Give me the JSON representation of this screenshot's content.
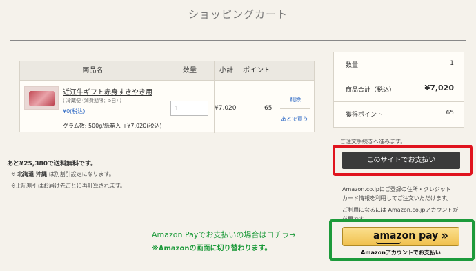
{
  "page": {
    "title": "ショッピングカート"
  },
  "cart": {
    "headers": {
      "product": "商品名",
      "quantity": "数量",
      "subtotal": "小計",
      "points": "ポイント"
    },
    "item": {
      "name": "近江牛ギフト赤身すきやき用",
      "note": "( 冷蔵便 (消費期限：5日) )",
      "price": "¥0(税込)",
      "option": "グラム数: 500g/紙箱入 +¥7,020(税込)",
      "quantity": "1",
      "subtotal": "¥7,020",
      "points": "65",
      "delete_label": "削除",
      "buy_later_label": "あとで買う"
    }
  },
  "shipping": {
    "free_shipping": "あと¥25,380で送料無料です。",
    "note1_prefix": "※",
    "note1_bold": "北海道 沖縄",
    "note1_suffix": "は別割引設定になります。",
    "note2": "※上記割引はお届け先ごとに再計算されます。"
  },
  "summary": {
    "quantity_label": "数量",
    "quantity_value": "1",
    "total_label": "商品合計（税込）",
    "total_value": "¥7,020",
    "points_label": "獲得ポイント",
    "points_value": "65"
  },
  "checkout": {
    "proceed_text": "ご注文手続きへ進みます。",
    "site_pay_label": "このサイトでお支払い",
    "amazon_info_1": "Amazon.co.jpにご登録の住所・クレジット",
    "amazon_info_2": "カード情報を利用してご注文いただけます。",
    "amazon_info_3": "ご利用になるには Amazon.co.jpアカウントが",
    "amazon_info_4": "必要です。",
    "amazon_logo": "amazon pay",
    "amazon_chevron": "»",
    "amazon_caption": "Amazonアカウントでお支払い"
  },
  "annotations": {
    "green_line1": "Amazon Payでお支払いの場合はコチラ→",
    "green_line2": "※Amazonの画面に切り替わります。"
  },
  "colors": {
    "red_frame": "#e0141e",
    "green_frame": "#1c9a3a",
    "link": "#2a66c4"
  }
}
